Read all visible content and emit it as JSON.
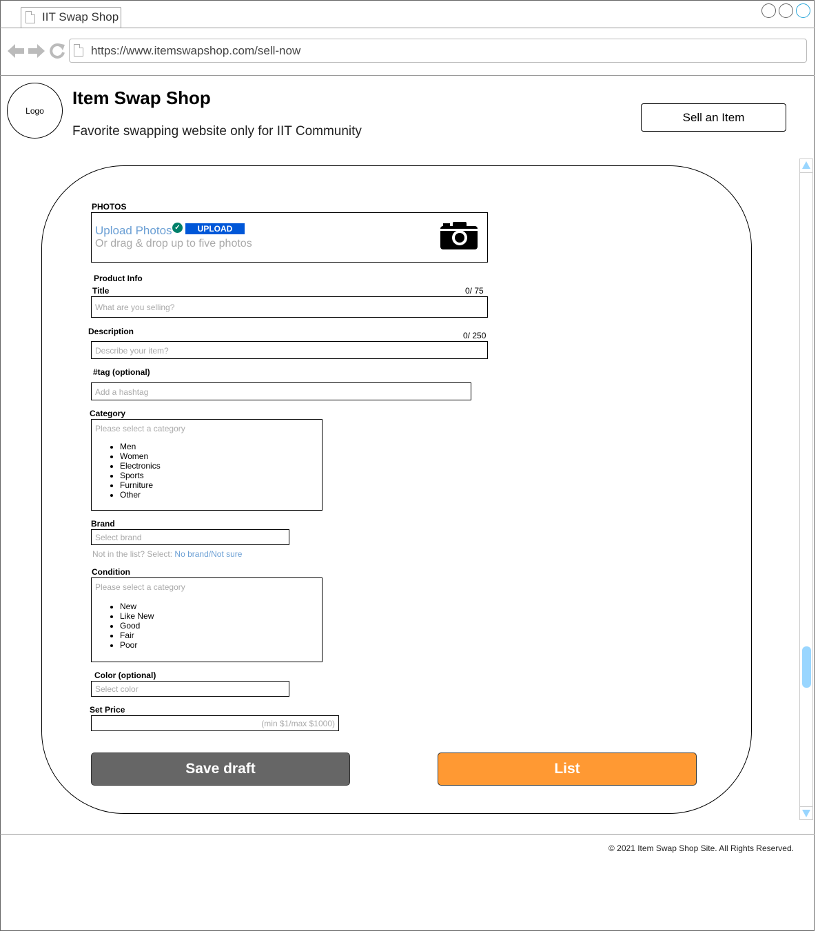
{
  "browser": {
    "tab_title": "IIT Swap Shop",
    "url": "https://www.itemswapshop.com/sell-now"
  },
  "header": {
    "logo_text": "Logo",
    "site_title": "Item Swap Shop",
    "subtitle": "Favorite swapping website only for IIT Community",
    "sell_button": "Sell an Item"
  },
  "form": {
    "photos": {
      "label": "PHOTOS",
      "upload_link": "Upload Photos",
      "upload_button": "UPLOAD",
      "hint": "Or drag & drop up to five photos"
    },
    "product_info_label": "Product Info",
    "title": {
      "label": "Title",
      "counter": "0/ 75",
      "placeholder": "What are you selling?"
    },
    "description": {
      "label": "Description",
      "counter": "0/ 250",
      "placeholder": "Describe your item?"
    },
    "tag": {
      "label": "#tag (optional)",
      "placeholder": "Add a hashtag"
    },
    "category": {
      "label": "Category",
      "placeholder": "Please select a category",
      "options": [
        "Men",
        "Women",
        "Electronics",
        "Sports",
        "Furniture",
        "Other"
      ]
    },
    "brand": {
      "label": "Brand",
      "placeholder": "Select brand",
      "hint": "Not in the list? Select:",
      "hint_link": "No brand/Not sure"
    },
    "condition": {
      "label": "Condition",
      "placeholder": "Please select a category",
      "options": [
        "New",
        "Like New",
        "Good",
        "Fair",
        "Poor"
      ]
    },
    "color": {
      "label": "Color (optional)",
      "placeholder": "Select color"
    },
    "price": {
      "label": "Set Price",
      "placeholder": "(min $1/max $1000)"
    },
    "save_button": "Save draft",
    "list_button": "List"
  },
  "footer": {
    "copyright": "© 2021 Item Swap Shop Site. All Rights Reserved."
  },
  "colors": {
    "link": "#6b9fd4",
    "upload_button": "#0057d8",
    "check": "#00806a",
    "save_button": "#666666",
    "list_button": "#ff9933",
    "scrollbar": "#99d6ff"
  }
}
